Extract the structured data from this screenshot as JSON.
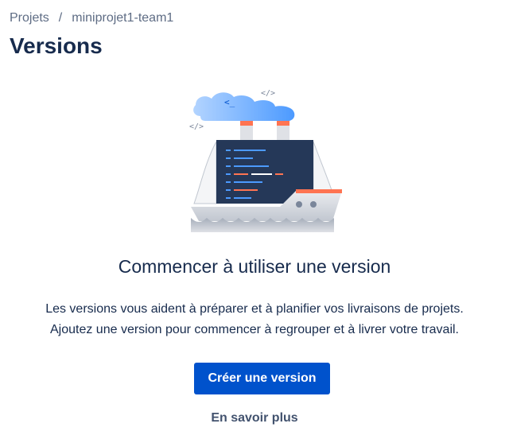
{
  "breadcrumb": {
    "projects_label": "Projets",
    "separator": "/",
    "project_name": "miniprojet1-team1"
  },
  "page": {
    "title": "Versions"
  },
  "empty_state": {
    "illustration": "ship-with-code-screen",
    "heading": "Commencer à utiliser une version",
    "description_line1": "Les versions vous aident à préparer et à planifier vos livraisons de projets.",
    "description_line2": "Ajoutez une version pour commencer à regrouper et à livrer votre travail.",
    "create_button_label": "Créer une version",
    "learn_more_label": "En savoir plus"
  },
  "colors": {
    "primary": "#0052cc",
    "text": "#172b4d",
    "subtle_text": "#5e6c84",
    "link_text": "#42526e",
    "accent_orange": "#ff7452",
    "screen_dark": "#253858"
  }
}
